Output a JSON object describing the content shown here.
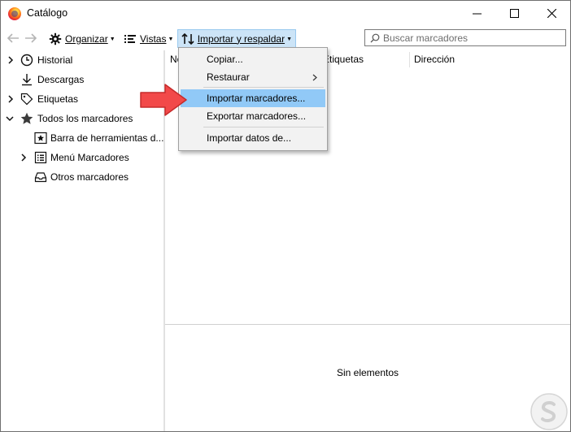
{
  "window": {
    "title": "Catálogo"
  },
  "toolbar": {
    "back_icon": "back-arrow-icon",
    "forward_icon": "forward-arrow-icon",
    "organize_label": "Organizar",
    "views_label": "Vistas",
    "import_backup_label": "Importar y respaldar"
  },
  "search": {
    "placeholder": "Buscar marcadores"
  },
  "sidebar": {
    "items": [
      {
        "label": "Historial",
        "icon": "clock-icon",
        "expandable": true
      },
      {
        "label": "Descargas",
        "icon": "download-icon",
        "expandable": false
      },
      {
        "label": "Etiquetas",
        "icon": "tag-icon",
        "expandable": true
      },
      {
        "label": "Todos los marcadores",
        "icon": "star-icon",
        "expanded": true
      },
      {
        "label": "Barra de herramientas d...",
        "icon": "bookmarks-toolbar-icon"
      },
      {
        "label": "Menú Marcadores",
        "icon": "bookmarks-menu-icon",
        "expandable": true
      },
      {
        "label": "Otros marcadores",
        "icon": "other-bookmarks-icon"
      }
    ]
  },
  "columns": {
    "name": "No",
    "tags": "Etiquetas",
    "location": "Dirección"
  },
  "details": {
    "empty_text": "Sin elementos"
  },
  "menu": {
    "copy": "Copiar...",
    "restore": "Restaurar",
    "import_bookmarks": "Importar marcadores...",
    "export_bookmarks": "Exportar marcadores...",
    "import_data": "Importar datos de..."
  },
  "colors": {
    "menu_highlight": "#91c9f7",
    "active_toolbar_button": "#cce4f7",
    "annotation_arrow": "#f24949"
  }
}
